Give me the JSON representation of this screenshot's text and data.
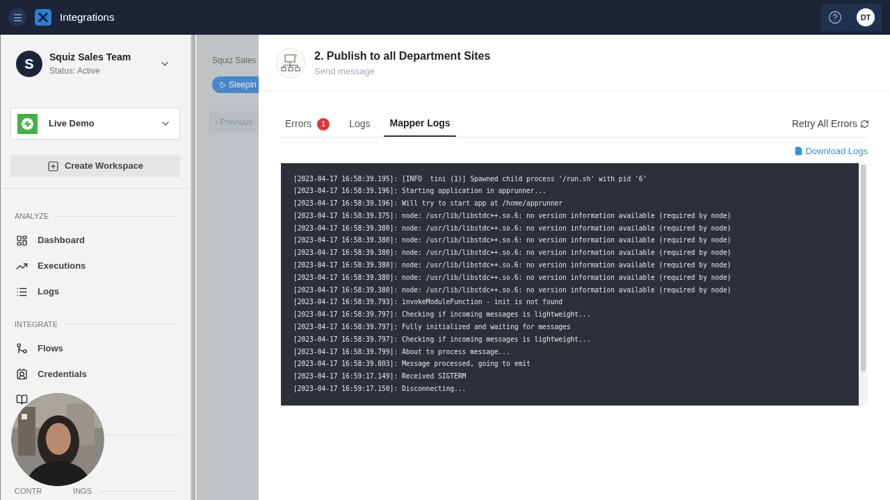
{
  "topbar": {
    "title": "Integrations",
    "avatar": "DT"
  },
  "sidebar": {
    "team": {
      "initial": "S",
      "name": "Squiz Sales Team",
      "status": "Status: Active"
    },
    "workspace": {
      "name": "Live Demo"
    },
    "create_button": "Create Workspace",
    "sections": [
      {
        "heading": "ANALYZE",
        "items": [
          {
            "kind": "dashboard",
            "label": "Dashboard"
          },
          {
            "kind": "executions",
            "label": "Executions"
          },
          {
            "kind": "logs",
            "label": "Logs"
          }
        ]
      },
      {
        "heading": "INTEGRATE",
        "items": [
          {
            "kind": "flows",
            "label": "Flows"
          },
          {
            "kind": "credentials",
            "label": "Credentials"
          },
          {
            "kind": "book"
          }
        ]
      }
    ],
    "hidden_heading_parts": [
      "CONTR",
      "INGS"
    ]
  },
  "background": {
    "breadcrumb": "Squiz Sales",
    "status_pill": "Sleepin",
    "previous": "‹ Previous"
  },
  "panel": {
    "title": "2. Publish to all Department Sites",
    "subtitle": "Send message",
    "tabs": [
      {
        "label": "Errors",
        "badge": "1",
        "selected": false
      },
      {
        "label": "Logs",
        "selected": false
      },
      {
        "label": "Mapper Logs",
        "selected": true
      }
    ],
    "retry": "Retry All Errors",
    "download": "Download Logs",
    "log_lines": [
      "[2023-04-17 16:58:39.195]: [INFO  tini (1)] Spawned child process '/run.sh' with pid '6'",
      "[2023-04-17 16:58:39.196]: Starting application in apprunner...",
      "[2023-04-17 16:58:39.196]: Will try to start app at /home/apprunner",
      "[2023-04-17 16:58:39.375]: node: /usr/lib/libstdc++.so.6: no version information available (required by node)",
      "[2023-04-17 16:58:39.380]: node: /usr/lib/libstdc++.so.6: no version information available (required by node)",
      "[2023-04-17 16:58:39.380]: node: /usr/lib/libstdc++.so.6: no version information available (required by node)",
      "[2023-04-17 16:58:39.380]: node: /usr/lib/libstdc++.so.6: no version information available (required by node)",
      "[2023-04-17 16:58:39.380]: node: /usr/lib/libstdc++.so.6: no version information available (required by node)",
      "[2023-04-17 16:58:39.380]: node: /usr/lib/libstdc++.so.6: no version information available (required by node)",
      "[2023-04-17 16:58:39.380]: node: /usr/lib/libstdc++.so.6: no version information available (required by node)",
      "[2023-04-17 16:58:39.793]: invokeModuleFunction - init is not found",
      "[2023-04-17 16:58:39.797]: Checking if incoming messages is lightweight...",
      "[2023-04-17 16:58:39.797]: Fully initialized and waiting for messages",
      "[2023-04-17 16:58:39.797]: Checking if incoming messages is lightweight...",
      "[2023-04-17 16:58:39.799]: About to process message...",
      "[2023-04-17 16:58:39.803]: Message processed, going to emit",
      "[2023-04-17 16:59:17.149]: Received SIGTERM",
      "[2023-04-17 16:59:17.150]: Disconnecting..."
    ]
  }
}
